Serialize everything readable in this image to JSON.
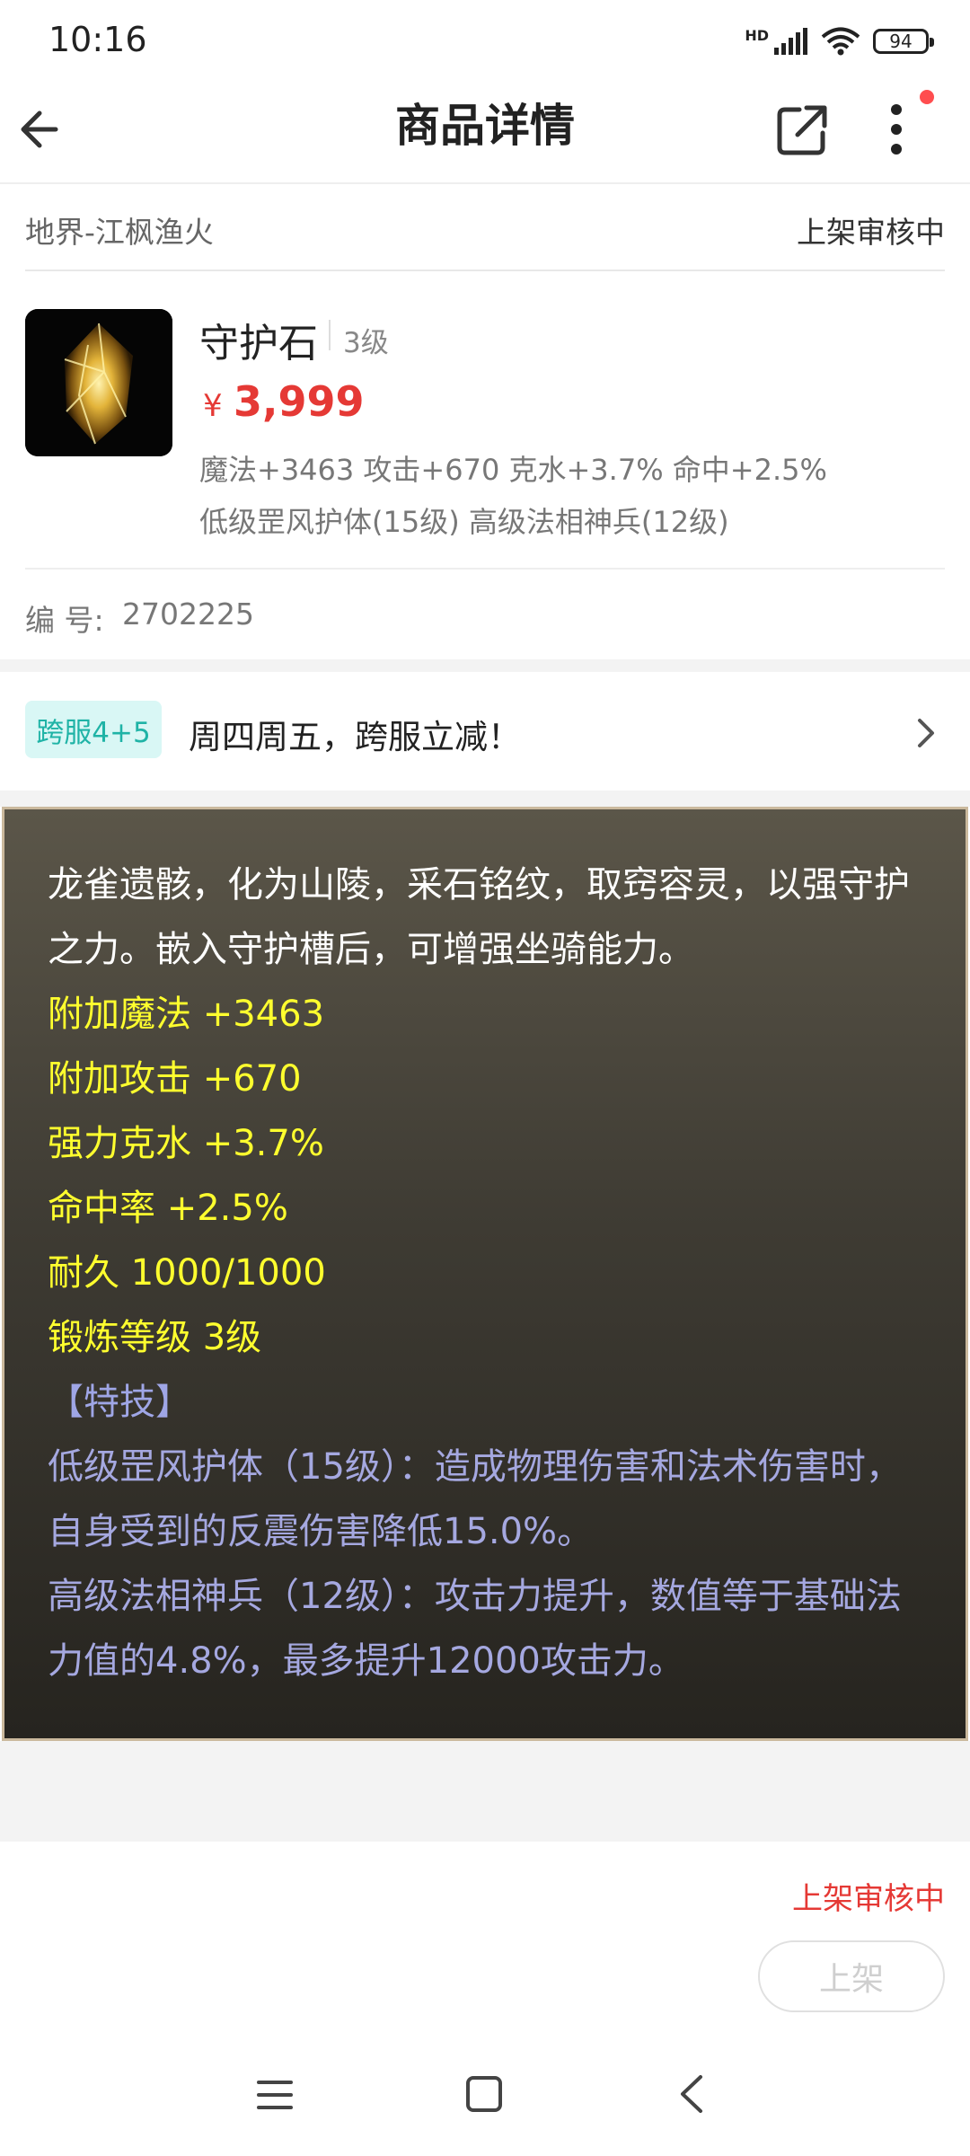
{
  "status_bar": {
    "time": "10:16",
    "network": "HD",
    "battery": "94"
  },
  "header": {
    "title": "商品详情"
  },
  "server": {
    "name": "地界-江枫渔火",
    "status": "上架审核中"
  },
  "product": {
    "name": "守护石",
    "level": "3级",
    "price_symbol": "¥",
    "price": "3,999",
    "attributes": "魔法+3463 攻击+670 克水+3.7% 命中+2.5%",
    "skills": "低级罡风护体(15级) 高级法相神兵(12级)",
    "serial_label": "编 号:",
    "serial_value": "2702225"
  },
  "promo": {
    "tag": "跨服4+5",
    "text": "周四周五，跨服立减！"
  },
  "description": {
    "lore": "龙雀遗骸，化为山陵，采石铭纹，取窍容灵，以强守护之力。嵌入守护槽后，可增强坐骑能力。",
    "stats": [
      "附加魔法 +3463",
      "附加攻击 +670",
      "强力克水 +3.7%",
      "命中率 +2.5%",
      "耐久 1000/1000",
      "锻炼等级 3级"
    ],
    "skills_header": "【特技】",
    "skill_lines": [
      "低级罡风护体（15级）：造成物理伤害和法术伤害时，自身受到的反震伤害降低15.0%。",
      "高级法相神兵（12级）：攻击力提升，数值等于基础法力值的4.8%，最多提升12000攻击力。"
    ]
  },
  "bottom": {
    "status": "上架审核中",
    "list_button": "上架"
  },
  "colors": {
    "price_red": "#e53935",
    "promo_teal": "#1fb3a6",
    "stat_yellow": "#ffff2e",
    "skill_purple": "#a5a8e0"
  }
}
